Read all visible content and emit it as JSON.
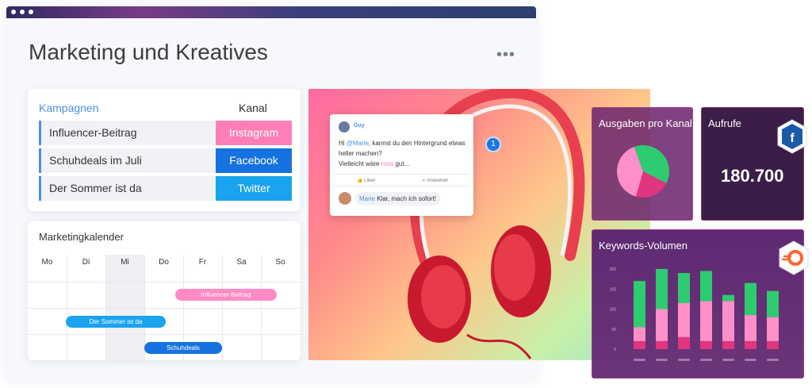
{
  "board": {
    "title": "Marketing und Kreatives",
    "more_icon": "more-dots-icon"
  },
  "campaigns": {
    "header": "Kampagnen",
    "channel_header": "Kanal",
    "rows": [
      {
        "name": "Influencer-Beitrag",
        "channel": "Instagram",
        "color": "#ff7eb8"
      },
      {
        "name": "Schuhdeals im Juli",
        "channel": "Facebook",
        "color": "#1572e0"
      },
      {
        "name": "Der Sommer ist da",
        "channel": "Twitter",
        "color": "#1aa3ee"
      }
    ]
  },
  "calendar": {
    "title": "Marketingkalender",
    "days": [
      "Mo",
      "Di",
      "Mi",
      "Do",
      "Fr",
      "Sa",
      "So"
    ],
    "events": [
      {
        "label": "Influencer-Beitrag",
        "color": "#ff8ac4"
      },
      {
        "label": "Der Sommer ist da",
        "color": "#1aa3ee"
      },
      {
        "label": "Schuhdeals",
        "color": "#1572e0"
      }
    ]
  },
  "chat": {
    "author": "Guy",
    "message_prefix": "Hi ",
    "mention": "@Marie",
    "message_rest": ", kannst du den Hintergrund etwas heller machen?",
    "message_line3_prefix": "Vielleicht wäre ",
    "highlight": "rosa",
    "message_line3_suffix": " gut...",
    "like_label": "Liken",
    "reply_label": "Antworten",
    "reply_author": "Marie",
    "reply_text": " Klar, mach ich sofort!",
    "notification_count": "1"
  },
  "widgets": {
    "spend_title": "Ausgaben pro Kanal",
    "views_title": "Aufrufe",
    "views_value": "180.700",
    "keywords_title": "Keywords-Volumen",
    "facebook_badge": "facebook-icon",
    "semrush_badge": "semrush-icon"
  },
  "chart_data": [
    {
      "type": "pie",
      "title": "Ausgaben pro Kanal",
      "slices": [
        {
          "value": 38,
          "color": "#2dcc70"
        },
        {
          "value": 22,
          "color": "#e0357f"
        },
        {
          "value": 40,
          "color": "#ff8fc8"
        }
      ]
    },
    {
      "type": "bar",
      "title": "Keywords-Volumen",
      "stacked": true,
      "yticks": [
        0,
        50,
        100,
        150,
        200
      ],
      "ylim": [
        0,
        200
      ],
      "series": [
        {
          "color": "#e0357f",
          "values": [
            20,
            20,
            30,
            20,
            20,
            20,
            20
          ]
        },
        {
          "color": "#ff8fc8",
          "values": [
            35,
            80,
            85,
            100,
            100,
            65,
            60
          ]
        },
        {
          "color": "#2dcc70",
          "values": [
            115,
            100,
            75,
            75,
            15,
            80,
            65
          ]
        }
      ],
      "colors": {
        "placeholder_labels": "#9a7fa8"
      }
    }
  ]
}
